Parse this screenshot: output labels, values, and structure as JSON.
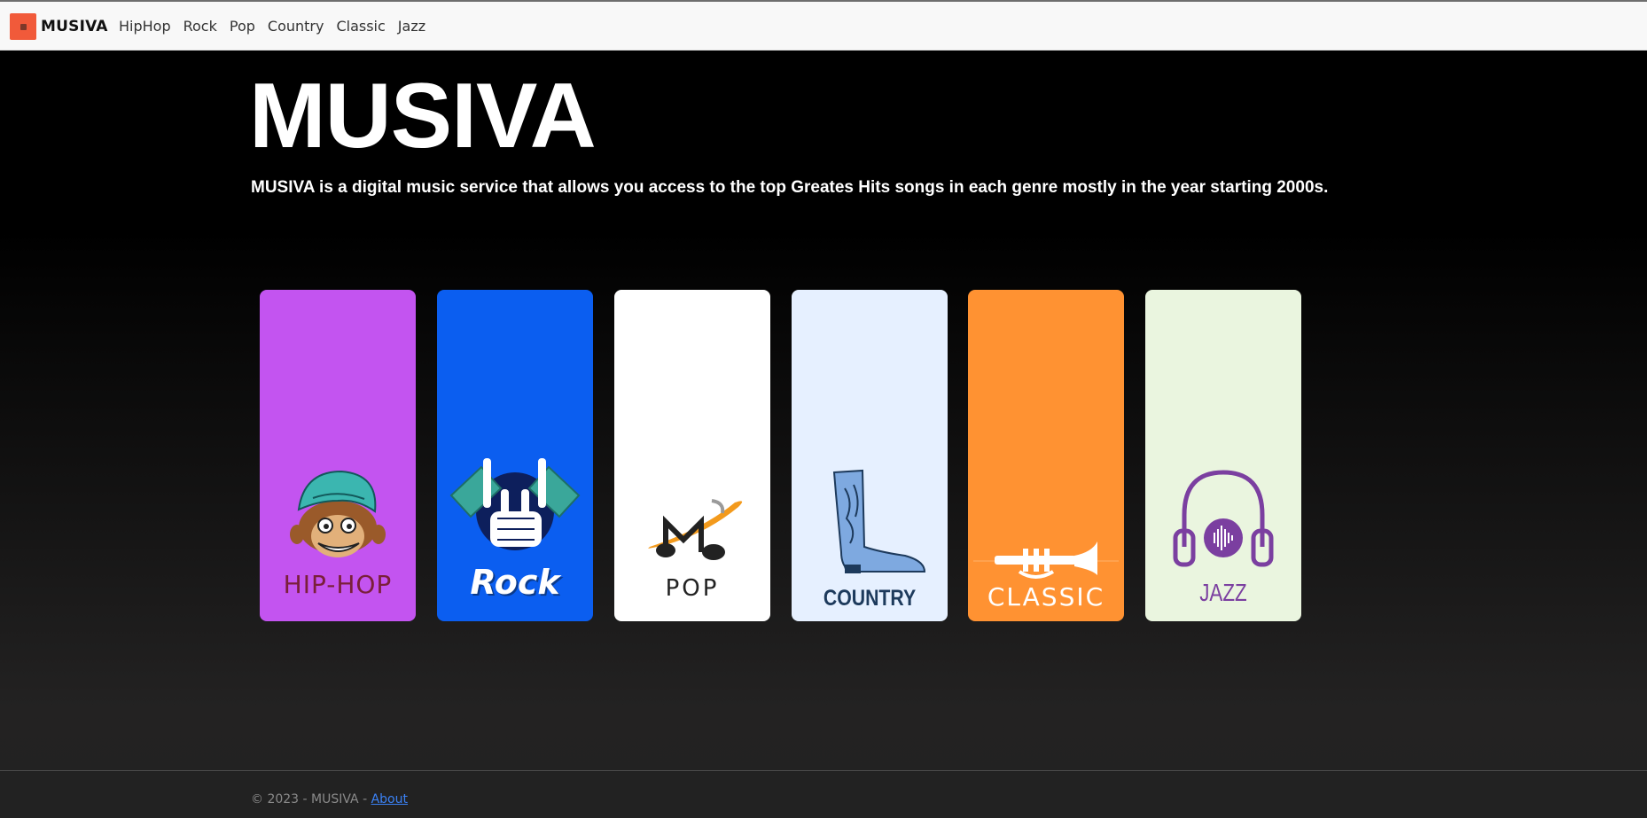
{
  "navbar": {
    "brand": "MUSIVA",
    "links": [
      "HipHop",
      "Rock",
      "Pop",
      "Country",
      "Classic",
      "Jazz"
    ]
  },
  "hero": {
    "title": "MUSIVA",
    "description": "MUSIVA is a digital music service that allows you access to the top Greates Hits songs in each genre mostly in the year starting 2000s."
  },
  "cards": [
    {
      "label": "HIP-HOP",
      "bg": "#c354f0",
      "icon": "monkey-beanie-icon",
      "text_color": "#7a1f3a"
    },
    {
      "label": "Rock",
      "bg": "#0b5ef0",
      "icon": "skeleton-rock-hand-icon",
      "text_color": "#ffffff"
    },
    {
      "label": "POP",
      "bg": "#ffffff",
      "icon": "music-note-m-icon",
      "text_color": "#222222"
    },
    {
      "label": "COUNTRY",
      "bg": "#e6f0ff",
      "icon": "cowboy-boot-icon",
      "text_color": "#1d3a5c"
    },
    {
      "label": "CLASSIC",
      "bg": "#ff9232",
      "icon": "trumpet-icon",
      "text_color": "#ffffff"
    },
    {
      "label": "JAZZ",
      "bg": "#eaf5df",
      "icon": "headphones-icon",
      "text_color": "#7b3fa0"
    }
  ],
  "footer": {
    "copyright": "© 2023 - MUSIVA - ",
    "about": "About"
  },
  "colors": {
    "navbar_bg": "#f8f8f8",
    "brand_logo": "#f15a3a",
    "link": "#3b82f6"
  }
}
